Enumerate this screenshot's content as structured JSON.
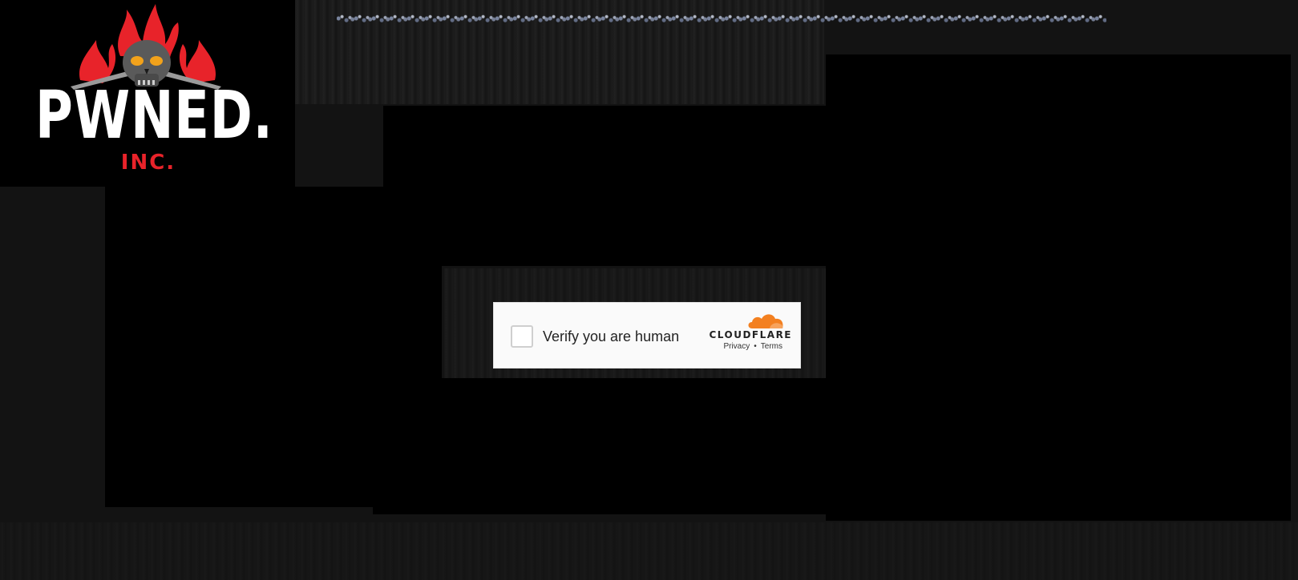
{
  "logo": {
    "main_text": "PWNED.",
    "sub_text": "INC.",
    "skull_icon": "flaming-skull-icon",
    "colors": {
      "flame": "#e8232a",
      "text": "#ffffff",
      "background": "#000000"
    }
  },
  "challenge": {
    "label": "Verify you are human",
    "checked": false
  },
  "cloudflare": {
    "wordmark": "CLOUDFLARE",
    "privacy_link": "Privacy",
    "separator": "•",
    "terms_link": "Terms",
    "brand_color": "#f38020"
  }
}
